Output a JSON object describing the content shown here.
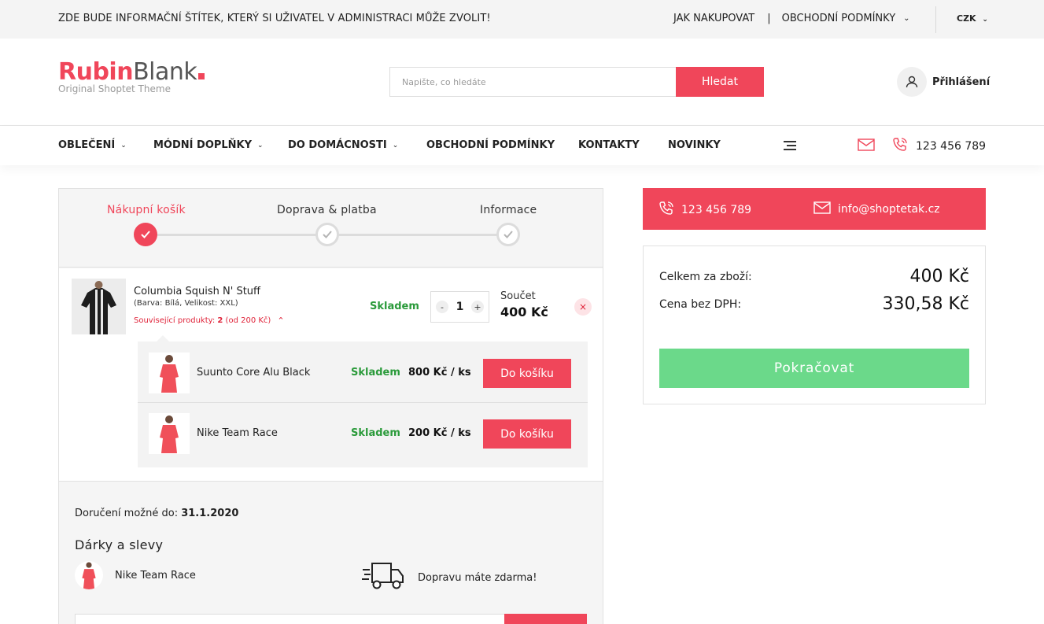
{
  "topbar": {
    "notice": "ZDE BUDE INFORMAČNÍ ŠTÍTEK, KTERÝ SI UŽIVATEL V ADMINISTRACI MŮŽE ZVOLIT!",
    "how_to_buy": "JAK NAKUPOVAT",
    "separator": "|",
    "terms": "OBCHODNÍ PODMÍNKY",
    "currency": "CZK"
  },
  "header": {
    "logo_rubin": "Rubin",
    "logo_blank": "Blank",
    "logo_sub": "Original Shoptet Theme",
    "search_placeholder": "Napište, co hledáte",
    "search_button": "Hledat",
    "login": "Přihlášení"
  },
  "nav": {
    "items": [
      "OBLEČENÍ",
      "MÓDNÍ DOPLŇKY",
      "DO DOMÁCNOSTI",
      "OBCHODNÍ PODMÍNKY",
      "KONTAKTY",
      "NOVINKY"
    ],
    "phone": "123 456 789"
  },
  "steps": [
    {
      "label": "Nákupní košík",
      "state": "active"
    },
    {
      "label": "Doprava & platba",
      "state": "inactive"
    },
    {
      "label": "Informace",
      "state": "inactive"
    }
  ],
  "cart_item": {
    "name": "Columbia Squish N' Stuff",
    "variant": "(Barva: Bílá, Velikost: XXL)",
    "related_prefix": "Související produkty:",
    "related_count": "2",
    "related_suffix": "(od 200 Kč)",
    "stock": "Skladem",
    "qty_minus": "-",
    "qty": "1",
    "qty_plus": "+",
    "sum_label": "Součet",
    "sum_value": "400 Kč",
    "remove": "×"
  },
  "related": [
    {
      "name": "Suunto Core Alu Black",
      "stock": "Skladem",
      "price": "800 Kč / ks",
      "button": "Do košíku"
    },
    {
      "name": "Nike Team Race",
      "stock": "Skladem",
      "price": "200 Kč / ks",
      "button": "Do košíku"
    }
  ],
  "lower": {
    "delivery_label": "Doručení možné do:",
    "delivery_date": "31.1.2020",
    "gifts_title": "Dárky a slevy",
    "gift_product": "Nike Team Race",
    "free_shipping": "Dopravu máte zdarma!"
  },
  "contact": {
    "phone": "123 456 789",
    "email": "info@shoptetak.cz"
  },
  "summary": {
    "total_label": "Celkem za zboží:",
    "total_value": "400 Kč",
    "net_label": "Cena bez DPH:",
    "net_value": "330,58 Kč",
    "continue": "Pokračovat"
  },
  "colors": {
    "accent": "#f0465a",
    "stock_green": "#2a9a3a",
    "continue_green": "#6bd98a"
  }
}
